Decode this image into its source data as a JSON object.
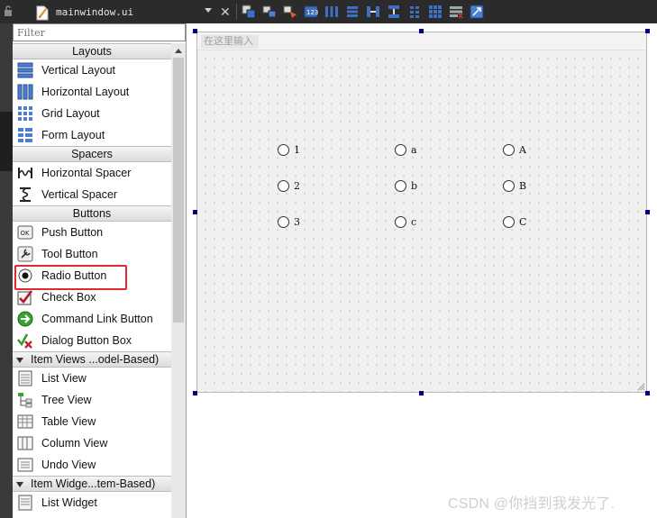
{
  "toolbar": {
    "file_name": "mainwindow.ui",
    "icons": [
      "edit-widgets-icon",
      "edit-signals-slots-icon",
      "edit-buddies-icon",
      "edit-tab-order-icon",
      "lay-out-horizontally-icon",
      "lay-out-vertically-icon",
      "lay-out-horizontal-splitter-icon",
      "lay-out-vertical-splitter-icon",
      "lay-out-form-icon",
      "lay-out-grid-icon",
      "break-layout-icon",
      "adjust-size-icon"
    ]
  },
  "widget_box": {
    "filter_placeholder": "Filter",
    "categories": [
      {
        "label": "Layouts",
        "items": [
          {
            "label": "Vertical Layout",
            "icon": "vertical-layout-icon"
          },
          {
            "label": "Horizontal Layout",
            "icon": "horizontal-layout-icon"
          },
          {
            "label": "Grid Layout",
            "icon": "grid-layout-icon"
          },
          {
            "label": "Form Layout",
            "icon": "form-layout-icon"
          }
        ]
      },
      {
        "label": "Spacers",
        "items": [
          {
            "label": "Horizontal Spacer",
            "icon": "horizontal-spacer-icon"
          },
          {
            "label": "Vertical Spacer",
            "icon": "vertical-spacer-icon"
          }
        ]
      },
      {
        "label": "Buttons",
        "items": [
          {
            "label": "Push Button",
            "icon": "push-button-icon"
          },
          {
            "label": "Tool Button",
            "icon": "tool-button-icon"
          },
          {
            "label": "Radio Button",
            "icon": "radio-button-icon"
          },
          {
            "label": "Check Box",
            "icon": "check-box-icon"
          },
          {
            "label": "Command Link Button",
            "icon": "command-link-icon"
          },
          {
            "label": "Dialog Button Box",
            "icon": "dialog-button-box-icon"
          }
        ]
      },
      {
        "label": "Item Views ...odel-Based)",
        "items": [
          {
            "label": "List View",
            "icon": "list-view-icon"
          },
          {
            "label": "Tree View",
            "icon": "tree-view-icon"
          },
          {
            "label": "Table View",
            "icon": "table-view-icon"
          },
          {
            "label": "Column View",
            "icon": "column-view-icon"
          },
          {
            "label": "Undo View",
            "icon": "undo-view-icon"
          }
        ]
      },
      {
        "label": "Item Widge...tem-Based)",
        "items": [
          {
            "label": "List Widget",
            "icon": "list-widget-icon"
          }
        ]
      }
    ]
  },
  "form": {
    "menu_placeholder": "在这里输入",
    "radios": [
      {
        "label": "1"
      },
      {
        "label": "a"
      },
      {
        "label": "A"
      },
      {
        "label": "2"
      },
      {
        "label": "b"
      },
      {
        "label": "B"
      },
      {
        "label": "3"
      },
      {
        "label": "c"
      },
      {
        "label": "C"
      }
    ]
  },
  "watermark": "CSDN @你挡到我发光了.",
  "colors": {
    "highlight": "#e0282e",
    "handle": "#000080",
    "topbar": "#2b2b2b"
  }
}
